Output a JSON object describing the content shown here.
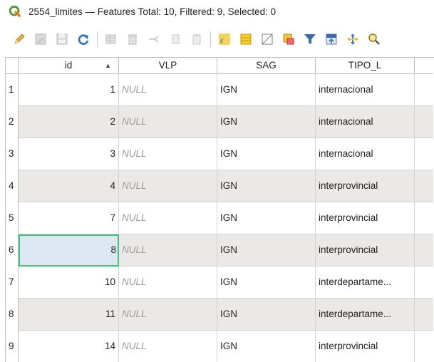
{
  "window": {
    "title": "2554_limites — Features Total: 10, Filtered: 9, Selected: 0",
    "icon": "qgis-logo-icon",
    "accent_color": "#589632"
  },
  "toolbar": {
    "buttons": [
      {
        "name": "toggle-editing",
        "icon": "pencil-icon",
        "enabled": true
      },
      {
        "name": "toggle-multi-edit",
        "icon": "multi-edit-icon",
        "enabled": false
      },
      {
        "name": "save-edits",
        "icon": "save-icon",
        "enabled": false
      },
      {
        "name": "reload-table",
        "icon": "reload-icon",
        "enabled": true
      },
      {
        "name": "add-feature",
        "icon": "add-feature-icon",
        "enabled": false
      },
      {
        "name": "delete-selected",
        "icon": "delete-icon",
        "enabled": false
      },
      {
        "name": "cut-selected",
        "icon": "cut-icon",
        "enabled": false
      },
      {
        "name": "copy-selected",
        "icon": "copy-icon",
        "enabled": false
      },
      {
        "name": "paste-features",
        "icon": "paste-icon",
        "enabled": false
      },
      {
        "name": "select-by-expression",
        "icon": "expression-select-icon",
        "enabled": true
      },
      {
        "name": "select-all",
        "icon": "select-all-icon",
        "enabled": true
      },
      {
        "name": "deselect-all",
        "icon": "deselect-icon",
        "enabled": true
      },
      {
        "name": "invert-selection",
        "icon": "invert-selection-icon",
        "enabled": true
      },
      {
        "name": "filter-select",
        "icon": "filter-icon",
        "enabled": true
      },
      {
        "name": "move-selection-top",
        "icon": "move-top-icon",
        "enabled": true
      },
      {
        "name": "pan-to-selected",
        "icon": "pan-icon",
        "enabled": true
      },
      {
        "name": "zoom-to-selected",
        "icon": "zoom-icon",
        "enabled": true
      }
    ]
  },
  "table": {
    "columns": [
      {
        "key": "id",
        "label": "id",
        "sorted": "ascending"
      },
      {
        "key": "vlp",
        "label": "VLP"
      },
      {
        "key": "sag",
        "label": "SAG"
      },
      {
        "key": "tipo",
        "label": "TIPO_L"
      }
    ],
    "sort_indicator": "▲",
    "focused_row": 6,
    "rows": [
      {
        "rownum": "1",
        "id": "1",
        "vlp": "NULL",
        "sag": "IGN",
        "tipo": "internacional"
      },
      {
        "rownum": "2",
        "id": "2",
        "vlp": "NULL",
        "sag": "IGN",
        "tipo": "internacional"
      },
      {
        "rownum": "3",
        "id": "3",
        "vlp": "NULL",
        "sag": "IGN",
        "tipo": "internacional"
      },
      {
        "rownum": "4",
        "id": "4",
        "vlp": "NULL",
        "sag": "IGN",
        "tipo": "interprovincial"
      },
      {
        "rownum": "5",
        "id": "7",
        "vlp": "NULL",
        "sag": "IGN",
        "tipo": "interprovincial"
      },
      {
        "rownum": "6",
        "id": "8",
        "vlp": "NULL",
        "sag": "IGN",
        "tipo": "interprovincial"
      },
      {
        "rownum": "7",
        "id": "10",
        "vlp": "NULL",
        "sag": "IGN",
        "tipo": "interdepartame..."
      },
      {
        "rownum": "8",
        "id": "11",
        "vlp": "NULL",
        "sag": "IGN",
        "tipo": "interdepartame..."
      },
      {
        "rownum": "9",
        "id": "14",
        "vlp": "NULL",
        "sag": "IGN",
        "tipo": "interprovincial"
      }
    ]
  }
}
